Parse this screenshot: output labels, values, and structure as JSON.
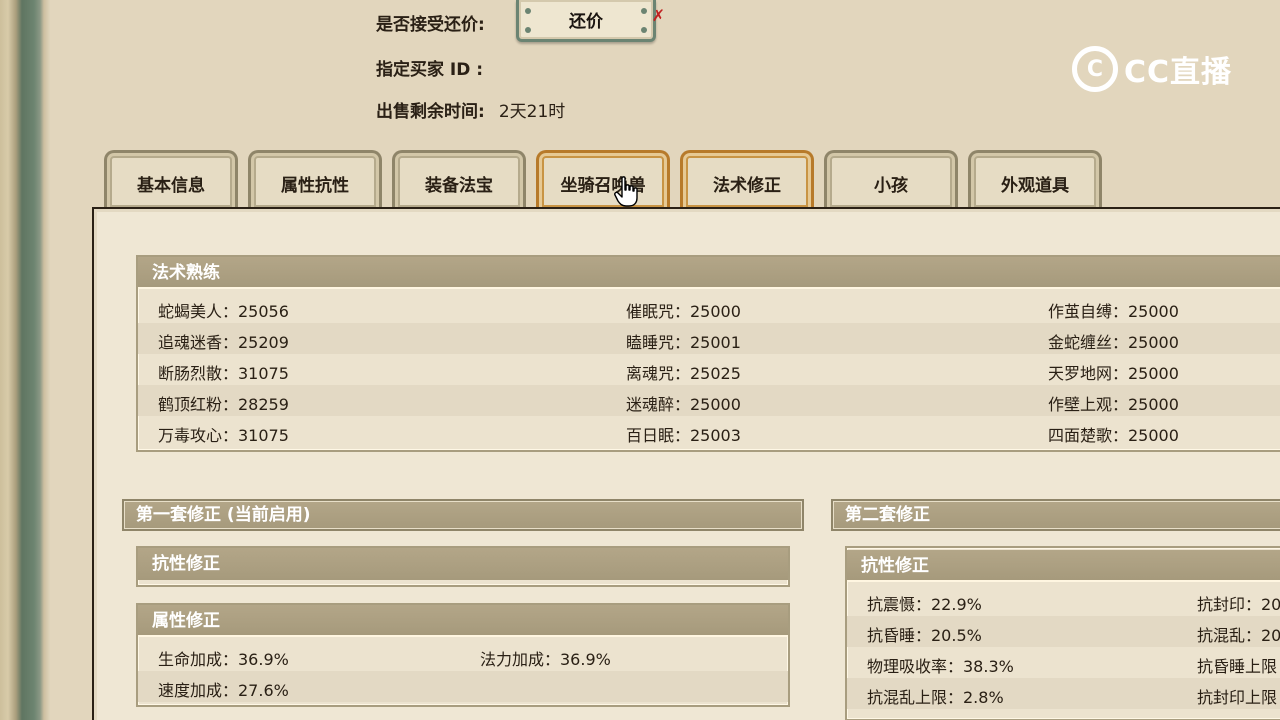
{
  "sale_info": {
    "accept_counter_label": "是否接受还价:",
    "counter_button_label": "还价",
    "buyer_id_label": "指定买家 ID :",
    "time_left_label": "出售剩余时间:",
    "time_left_value": "2天21时"
  },
  "logo": {
    "text": "CC直播",
    "mark": "C"
  },
  "tabs": [
    {
      "label": "基本信息"
    },
    {
      "label": "属性抗性"
    },
    {
      "label": "装备法宝"
    },
    {
      "label": "坐骑召唤兽"
    },
    {
      "label": "法术修正"
    },
    {
      "label": "小孩"
    },
    {
      "label": "外观道具"
    }
  ],
  "spell_mastery": {
    "title": "法术熟练",
    "rows": [
      [
        "蛇蝎美人：25056",
        "催眠咒：25000",
        "作茧自缚：25000"
      ],
      [
        "追魂迷香：25209",
        "瞌睡咒：25001",
        "金蛇缠丝：25000"
      ],
      [
        "断肠烈散：31075",
        "离魂咒：25025",
        "天罗地网：25000"
      ],
      [
        "鹤顶红粉：28259",
        "迷魂醉：25000",
        "作壁上观：25000"
      ],
      [
        "万毒攻心：31075",
        "百日眠：25003",
        "四面楚歌：25000"
      ]
    ]
  },
  "set1": {
    "title": "第一套修正 (当前启用)",
    "resist_title": "抗性修正",
    "attr_title": "属性修正",
    "attr_rows": [
      [
        "生命加成：36.9%",
        "法力加成：36.9%"
      ],
      [
        "速度加成：27.6%",
        ""
      ]
    ]
  },
  "set2": {
    "title": "第二套修正",
    "resist_title": "抗性修正",
    "rows": [
      [
        "抗震慑：22.9%",
        "抗封印：20"
      ],
      [
        "抗昏睡：20.5%",
        "抗混乱：20"
      ],
      [
        "物理吸收率：38.3%",
        "抗昏睡上限"
      ],
      [
        "抗混乱上限：2.8%",
        "抗封印上限"
      ]
    ]
  },
  "colors": {
    "accent": "#b77a2a",
    "header": "#a69a7c",
    "frame_green": "#6b8472"
  }
}
